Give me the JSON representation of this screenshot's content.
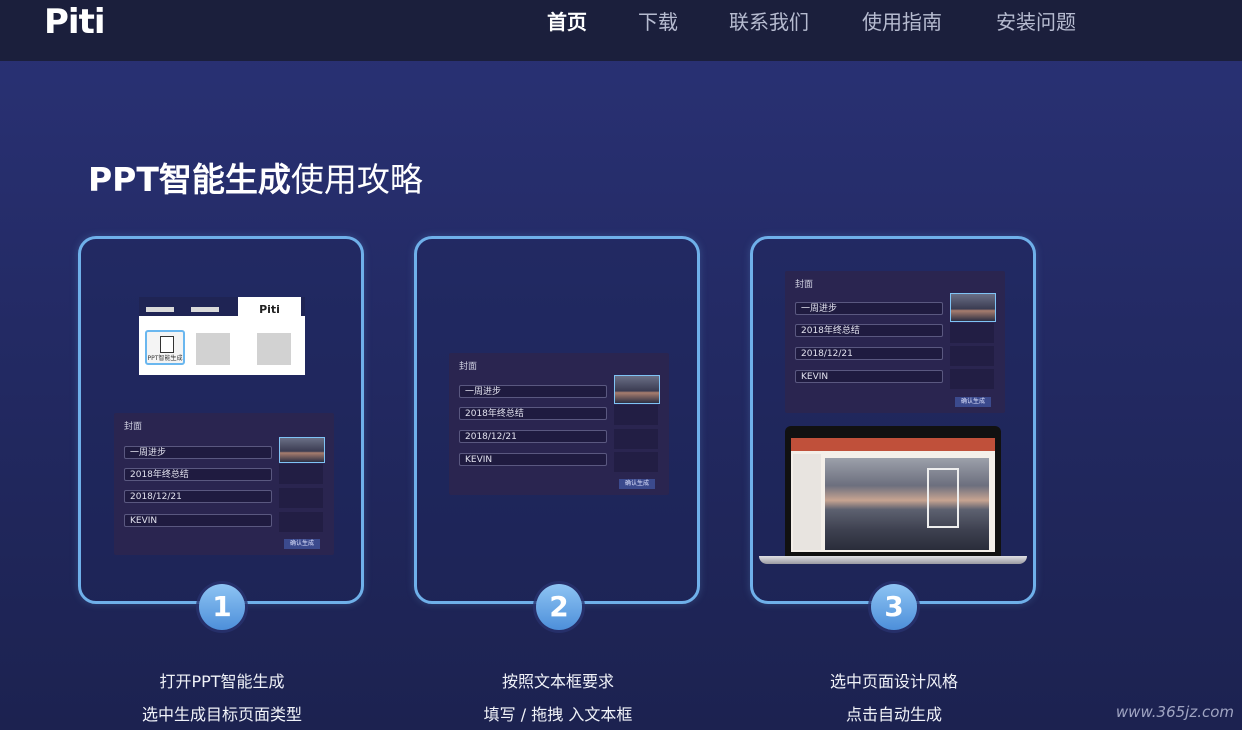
{
  "header": {
    "logo": "Piti",
    "nav": [
      {
        "label": "首页",
        "active": true
      },
      {
        "label": "下载",
        "active": false
      },
      {
        "label": "联系我们",
        "active": false
      },
      {
        "label": "使用指南",
        "active": false
      },
      {
        "label": "安装问题",
        "active": false
      }
    ]
  },
  "hero": {
    "title_bold": "PPT智能生成",
    "title_rest": "使用攻略"
  },
  "form": {
    "title": "封面",
    "fields": [
      "一周进步",
      "2018年终总结",
      "2018/12/21",
      "KEVIN"
    ],
    "confirm": "确认生成"
  },
  "window": {
    "tab_label": "Piti",
    "icon_label": "PPT智能生成"
  },
  "steps": [
    {
      "number": "1",
      "line1": "打开PPT智能生成",
      "line2": "选中生成目标页面类型"
    },
    {
      "number": "2",
      "line1": "按照文本框要求",
      "line2": "填写 / 拖拽 入文本框"
    },
    {
      "number": "3",
      "line1": "选中页面设计风格",
      "line2": "点击自动生成"
    }
  ],
  "watermark": "www.365jz.com",
  "colors": {
    "accent": "#6fb0ea",
    "background": "#232a64",
    "topbar": "#1b1f3c"
  }
}
